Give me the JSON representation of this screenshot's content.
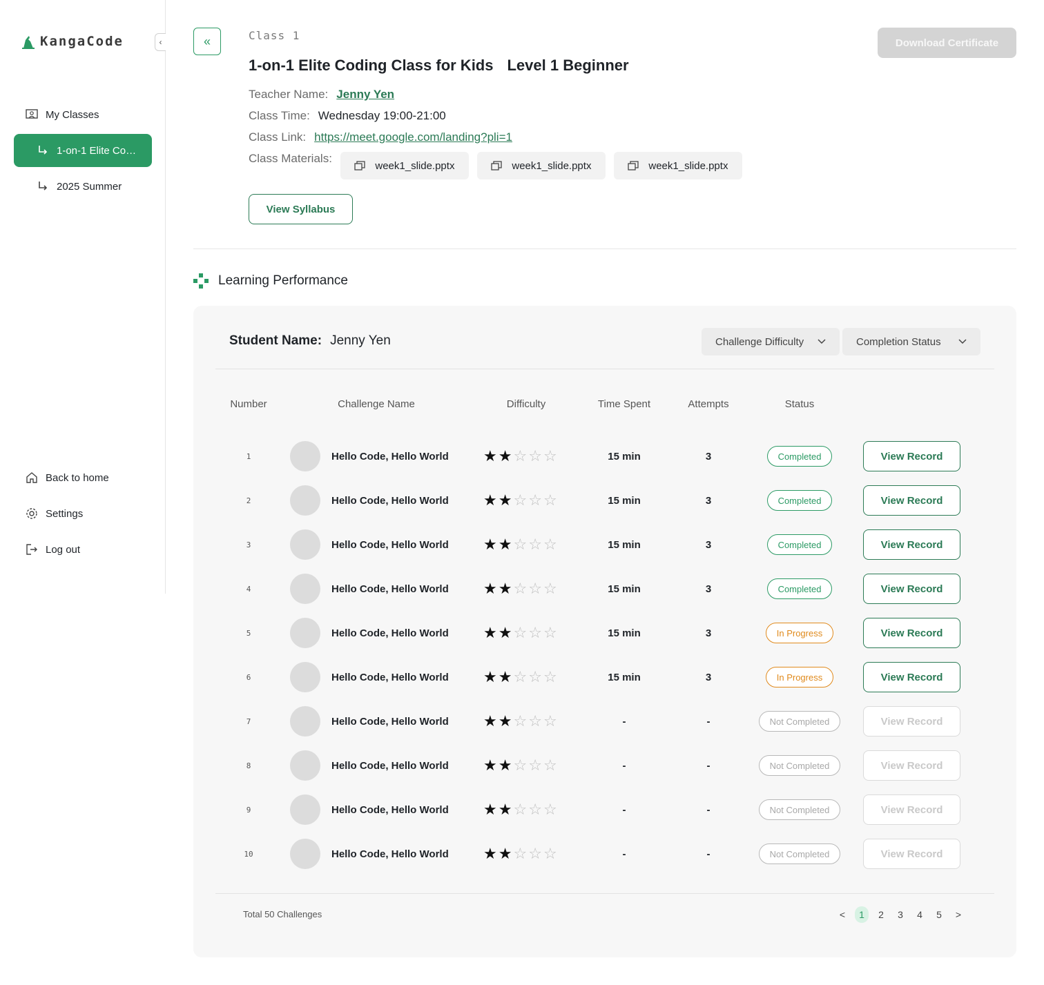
{
  "brand": {
    "name": "KangaCode",
    "accent": "#2b9a64",
    "link_color": "#2b7a55"
  },
  "sidebar": {
    "collapse_icon": "chevron-left-icon",
    "my_classes": "My Classes",
    "active_class": "1-on-1 Elite Cod···",
    "sub_item": "2025 Summer",
    "back_home": "Back to home",
    "settings": "Settings",
    "logout": "Log out"
  },
  "header": {
    "class_label": "Class 1",
    "title": "1-on-1 Elite Coding Class for Kids",
    "level": "Level 1 Beginner",
    "download_label": "Download Certificate",
    "teacher_key": "Teacher Name:",
    "teacher_value": "Jenny Yen",
    "time_key": "Class Time:",
    "time_value": "Wednesday 19:00-21:00",
    "link_key": "Class Link:",
    "link_value": "https://meet.google.com/landing?pli=1",
    "materials_key": "Class Materials:",
    "materials": [
      "week1_slide.pptx",
      "week1_slide.pptx",
      "week1_slide.pptx"
    ],
    "syllabus_label": "View Syllabus"
  },
  "performance": {
    "section_title": "Learning Performance",
    "student_key": "Student Name:",
    "student_value": "Jenny Yen",
    "filter_difficulty": "Challenge Difficulty",
    "filter_status": "Completion Status",
    "columns": {
      "number": "Number",
      "name": "Challenge Name",
      "difficulty": "Difficulty",
      "time": "Time Spent",
      "attempts": "Attempts",
      "status": "Status"
    },
    "rows": [
      {
        "num": "1",
        "name": "Hello Code, Hello World",
        "stars": 2,
        "time": "15 min",
        "attempts": "3",
        "status": "Completed",
        "kind": "completed",
        "action": "View Record"
      },
      {
        "num": "2",
        "name": "Hello Code, Hello World",
        "stars": 2,
        "time": "15 min",
        "attempts": "3",
        "status": "Completed",
        "kind": "completed",
        "action": "View Record"
      },
      {
        "num": "3",
        "name": "Hello Code, Hello World",
        "stars": 2,
        "time": "15 min",
        "attempts": "3",
        "status": "Completed",
        "kind": "completed",
        "action": "View Record"
      },
      {
        "num": "4",
        "name": "Hello Code, Hello World",
        "stars": 2,
        "time": "15 min",
        "attempts": "3",
        "status": "Completed",
        "kind": "completed",
        "action": "View Record"
      },
      {
        "num": "5",
        "name": "Hello Code, Hello World",
        "stars": 2,
        "time": "15 min",
        "attempts": "3",
        "status": "In Progress",
        "kind": "progress",
        "action": "View Record"
      },
      {
        "num": "6",
        "name": "Hello Code, Hello World",
        "stars": 2,
        "time": "15 min",
        "attempts": "3",
        "status": "In Progress",
        "kind": "progress",
        "action": "View Record"
      },
      {
        "num": "7",
        "name": "Hello Code, Hello World",
        "stars": 2,
        "time": "-",
        "attempts": "-",
        "status": "Not Completed",
        "kind": "not",
        "action": "View Record"
      },
      {
        "num": "8",
        "name": "Hello Code, Hello World",
        "stars": 2,
        "time": "-",
        "attempts": "-",
        "status": "Not Completed",
        "kind": "not",
        "action": "View Record"
      },
      {
        "num": "9",
        "name": "Hello Code, Hello World",
        "stars": 2,
        "time": "-",
        "attempts": "-",
        "status": "Not Completed",
        "kind": "not",
        "action": "View Record"
      },
      {
        "num": "10",
        "name": "Hello Code, Hello World",
        "stars": 2,
        "time": "-",
        "attempts": "-",
        "status": "Not Completed",
        "kind": "not",
        "action": "View Record"
      }
    ],
    "total": "Total 50 Challenges",
    "pager": {
      "prev": "<",
      "pages": [
        "1",
        "2",
        "3",
        "4",
        "5"
      ],
      "current": "1",
      "next": ">"
    }
  }
}
